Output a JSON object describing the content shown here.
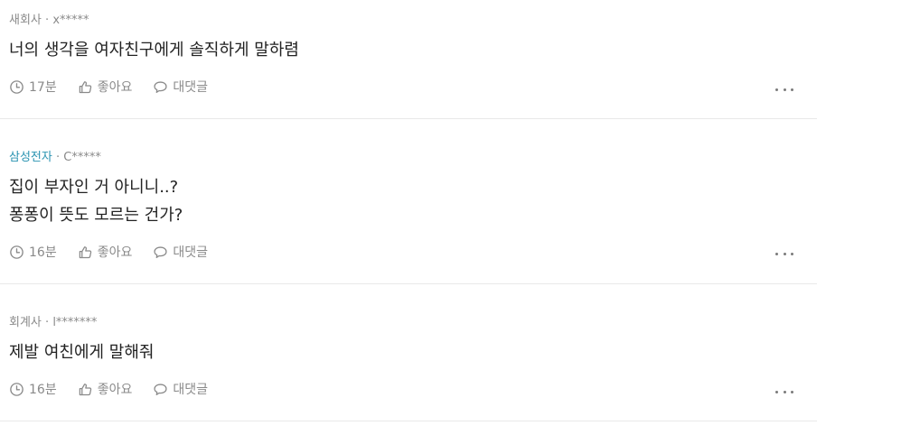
{
  "comments": [
    {
      "company": "새회사",
      "separator": "·",
      "user": "x*****",
      "lines": [
        "너의 생각을 여자친구에게 솔직하게 말하렴"
      ],
      "time": "17분",
      "like_label": "좋아요",
      "reply_label": "대댓글"
    },
    {
      "company": "삼성전자",
      "separator": "·",
      "user": "C*****",
      "lines": [
        "집이 부자인 거 아니니..?",
        "퐁퐁이 뜻도 모르는 건가?"
      ],
      "time": "16분",
      "like_label": "좋아요",
      "reply_label": "대댓글"
    },
    {
      "company": "회계사",
      "separator": "·",
      "user": "l*******",
      "lines": [
        "제발 여친에게 말해줘"
      ],
      "time": "16분",
      "like_label": "좋아요",
      "reply_label": "대댓글"
    }
  ],
  "colors": {
    "text": "#222222",
    "muted": "#8a8a8a",
    "verified_company": "#2a93b1",
    "divider": "#e9e9e9"
  },
  "icons": [
    "clock-icon",
    "thumbs-up-icon",
    "speech-bubble-icon",
    "more-dots-icon"
  ]
}
